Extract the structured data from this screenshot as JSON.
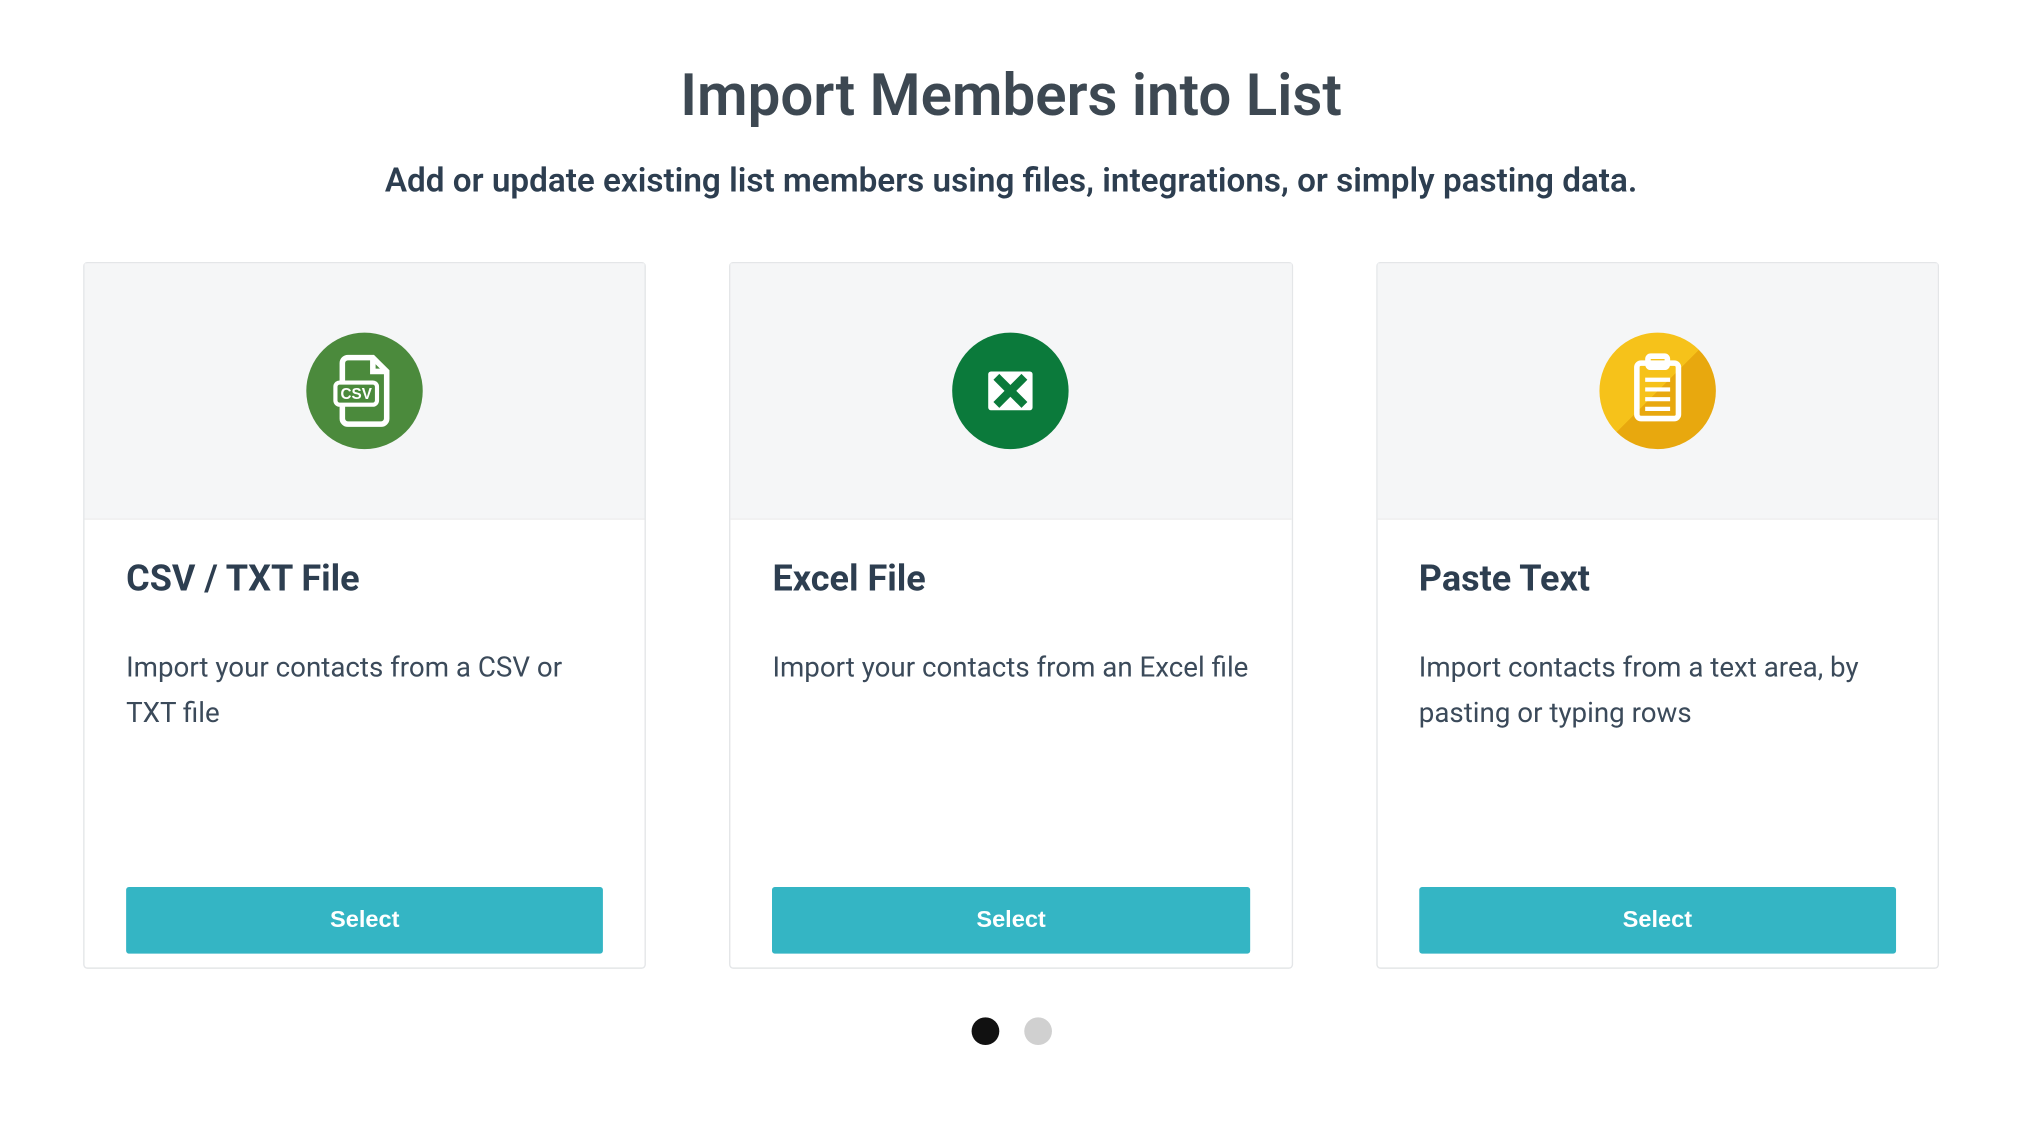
{
  "header": {
    "title": "Import Members into List",
    "subtitle": "Add or update existing list members using files, integrations, or simply pasting data."
  },
  "cards": [
    {
      "icon": "csv-file-icon",
      "title": "CSV / TXT File",
      "description": "Import your contacts from a CSV or TXT file",
      "button_label": "Select"
    },
    {
      "icon": "excel-file-icon",
      "title": "Excel File",
      "description": "Import your contacts from an Excel file",
      "button_label": "Select"
    },
    {
      "icon": "clipboard-icon",
      "title": "Paste Text",
      "description": "Import contacts from a text area, by pasting or typing rows",
      "button_label": "Select"
    }
  ],
  "pager": {
    "total": 2,
    "active_index": 0
  }
}
